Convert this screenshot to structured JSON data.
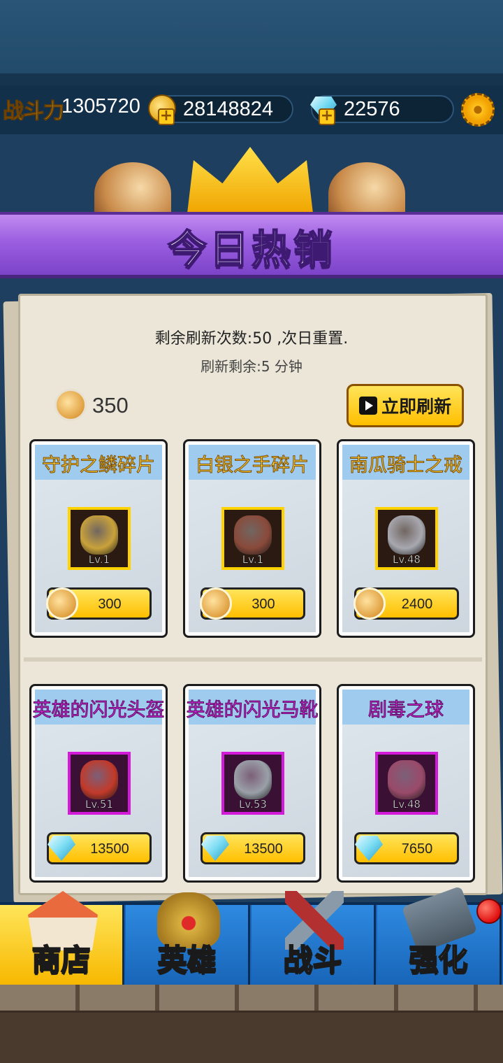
{
  "header": {
    "power_label": "战斗力",
    "power_value": "1305720",
    "gold_value": "28148824",
    "gems_value": "22576",
    "icons": [
      "gold-coin-icon",
      "gem-icon",
      "settings-gear-icon"
    ]
  },
  "banner": {
    "title": "今日热销"
  },
  "shop": {
    "refresh_count_text": "剩余刷新次数:50 ,次日重置.",
    "refresh_timer_text": "刷新剩余:5 分钟",
    "coin_balance": "350",
    "refresh_button_label": "立即刷新",
    "items": [
      {
        "name": "守护之鳞碎片",
        "level": "Lv.1",
        "price": "300",
        "currency": "coin",
        "rarity": "gold",
        "art_color": "#c9a23a"
      },
      {
        "name": "白银之手碎片",
        "level": "Lv.1",
        "price": "300",
        "currency": "coin",
        "rarity": "gold",
        "art_color": "#8a4a3a"
      },
      {
        "name": "南瓜骑士之戒",
        "level": "Lv.48",
        "price": "2400",
        "currency": "coin",
        "rarity": "gold",
        "art_color": "#a8a8b0"
      },
      {
        "name": "英雄的闪光头盔",
        "level": "Lv.51",
        "price": "13500",
        "currency": "gem",
        "rarity": "purple",
        "art_color": "#c23a2a"
      },
      {
        "name": "英雄的闪光马靴",
        "level": "Lv.53",
        "price": "13500",
        "currency": "gem",
        "rarity": "purple",
        "art_color": "#9aa0a8"
      },
      {
        "name": "剧毒之球",
        "level": "Lv.48",
        "price": "7650",
        "currency": "gem",
        "rarity": "purple",
        "art_color": "#9a4a6a"
      }
    ]
  },
  "nav": {
    "tabs": [
      {
        "label": "商店",
        "icon": "shop-icon",
        "active": true
      },
      {
        "label": "英雄",
        "icon": "hero-helmet-icon",
        "active": false
      },
      {
        "label": "战斗",
        "icon": "crossed-swords-icon",
        "active": false
      },
      {
        "label": "强化",
        "icon": "hammer-icon",
        "active": false
      }
    ]
  },
  "colors": {
    "banner_purple": "#9a5ee0",
    "button_yellow": "#ffc61a",
    "nav_blue": "#1a64b8",
    "rarity_gold": "#ffd200",
    "rarity_purple": "#d21ad8"
  }
}
